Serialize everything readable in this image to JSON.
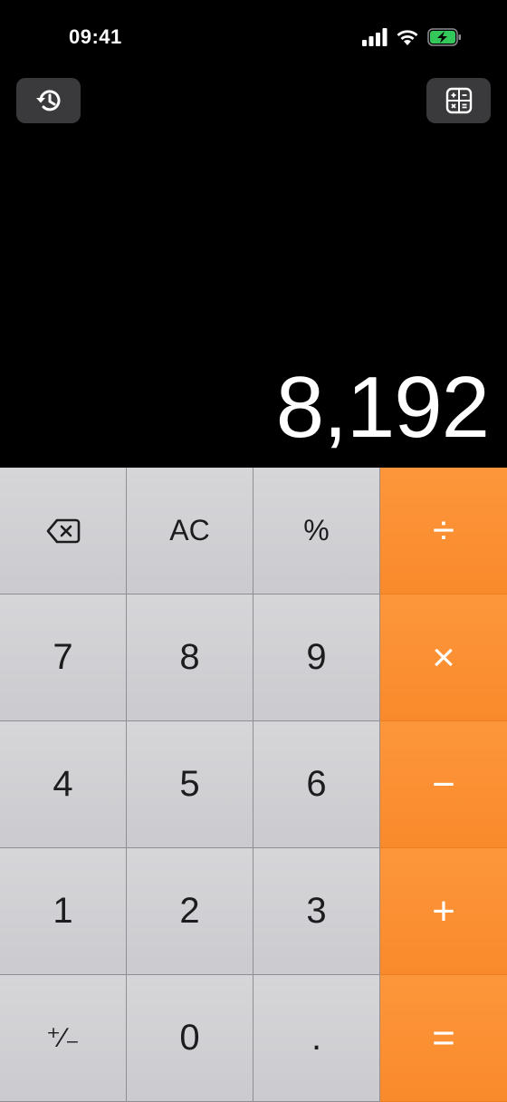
{
  "status": {
    "time": "09:41"
  },
  "toolbar": {
    "history_icon": "history-icon",
    "mode_icon": "calculator-grid-icon"
  },
  "display": {
    "value": "8,192"
  },
  "keys": {
    "backspace": "⌫",
    "clear": "AC",
    "percent": "%",
    "divide": "÷",
    "seven": "7",
    "eight": "8",
    "nine": "9",
    "multiply": "×",
    "four": "4",
    "five": "5",
    "six": "6",
    "minus": "−",
    "one": "1",
    "two": "2",
    "three": "3",
    "plus": "+",
    "negate": "⁺∕₋",
    "zero": "0",
    "decimal": ".",
    "equals": "="
  },
  "colors": {
    "operator": "#fd963b",
    "digit_key": "#d6d6d9",
    "background": "#000000",
    "battery": "#34c759"
  }
}
